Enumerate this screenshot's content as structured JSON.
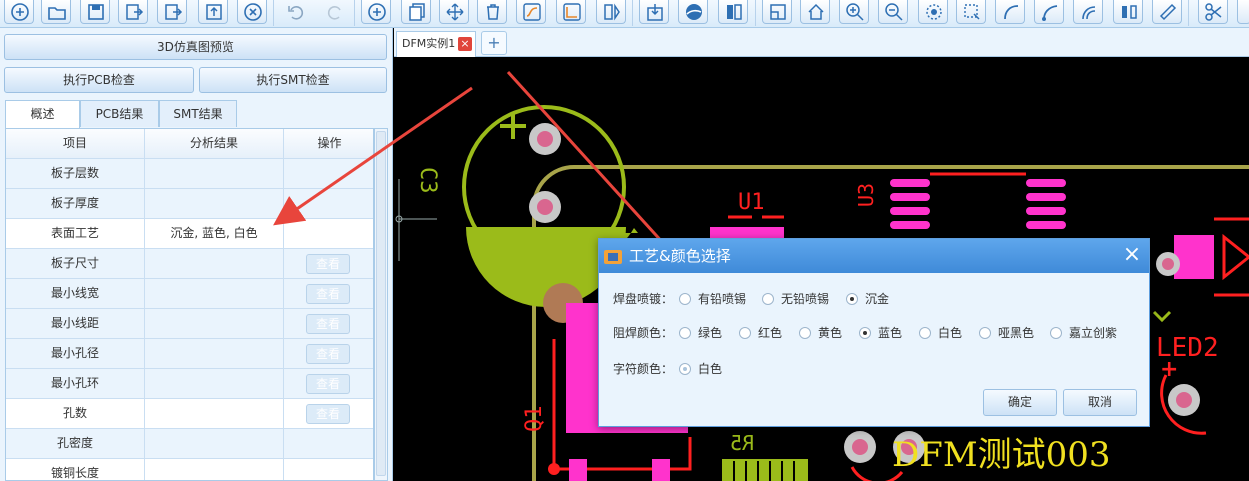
{
  "left_panel": {
    "preview_button": "3D仿真图预览",
    "pcb_check_button": "执行PCB检查",
    "smt_check_button": "执行SMT检查",
    "tabs": [
      "概述",
      "PCB结果",
      "SMT结果"
    ],
    "table": {
      "headers": [
        "项目",
        "分析结果",
        "操作"
      ],
      "rows": [
        {
          "item": "板子层数",
          "result": "",
          "action": ""
        },
        {
          "item": "板子厚度",
          "result": "",
          "action": ""
        },
        {
          "item": "表面工艺",
          "result": "沉金, 蓝色, 白色",
          "action": ""
        },
        {
          "item": "板子尺寸",
          "result": "",
          "action": "查看"
        },
        {
          "item": "最小线宽",
          "result": "",
          "action": "查看"
        },
        {
          "item": "最小线距",
          "result": "",
          "action": "查看"
        },
        {
          "item": "最小孔径",
          "result": "",
          "action": "查看"
        },
        {
          "item": "最小孔环",
          "result": "",
          "action": "查看"
        },
        {
          "item": "孔数",
          "result": "",
          "action": "查看"
        },
        {
          "item": "孔密度",
          "result": "",
          "action": ""
        },
        {
          "item": "镀铜长度",
          "result": "",
          "action": ""
        }
      ]
    }
  },
  "document": {
    "tab_label": "DFM实例1",
    "close_symbol": "×",
    "add_symbol": "+"
  },
  "canvas": {
    "labels": {
      "u1": "U1",
      "u3": "U3",
      "c3": "C3",
      "q1": "Q1",
      "r5": "R5",
      "led2": "LED2",
      "plus": "+",
      "board_text": "DFM测试003"
    }
  },
  "dialog": {
    "title": "工艺&颜色选择",
    "close_symbol": "×",
    "pad_finish": {
      "label": "焊盘喷镀：",
      "options": [
        "有铅喷锡",
        "无铅喷锡",
        "沉金"
      ],
      "selected": "沉金"
    },
    "solder_mask": {
      "label": "阻焊颜色：",
      "options": [
        "绿色",
        "红色",
        "黄色",
        "蓝色",
        "白色",
        "哑黑色",
        "嘉立创紫"
      ],
      "selected": "蓝色"
    },
    "silkscreen": {
      "label": "字符颜色：",
      "options": [
        "白色"
      ],
      "selected": "白色"
    },
    "ok_button": "确定",
    "cancel_button": "取消"
  },
  "colors": {
    "canvas_bg": "#000000",
    "board_outline": "#a8a44a",
    "pad_magenta": "#ff33cc",
    "silkscreen_red": "#ff2020",
    "c3_yellow_green": "#9bbb1a",
    "pin_pink": "#d9668f",
    "annotation_arrow": "#e8453c",
    "dialog_header": "#4a93df"
  }
}
